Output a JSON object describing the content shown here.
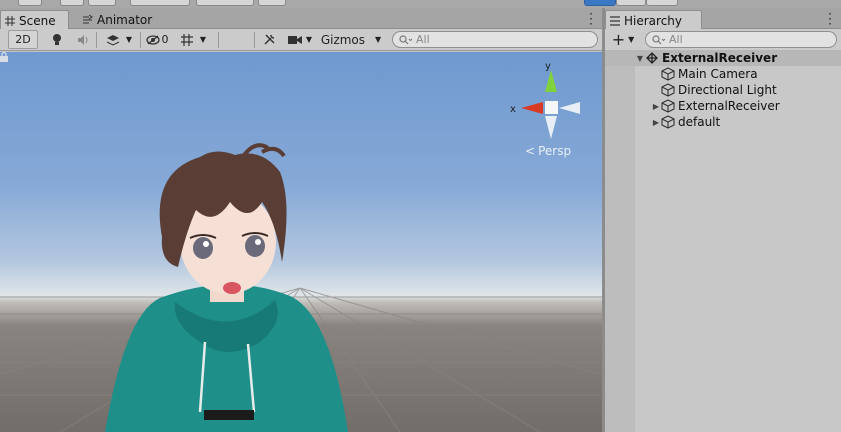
{
  "scene_window": {
    "tabs": [
      {
        "label": "Scene",
        "icon": "grid-icon",
        "active": true
      },
      {
        "label": "Animator",
        "icon": "animator-icon",
        "active": false
      }
    ],
    "toolbar": {
      "mode_2d": "2D",
      "hidden_count": "0",
      "gizmos_label": "Gizmos",
      "search_placeholder": "All"
    },
    "gizmo": {
      "x_label": "x",
      "y_label": "y",
      "projection_label": "Persp"
    }
  },
  "hierarchy": {
    "tab_label": "Hierarchy",
    "search_placeholder": "All",
    "items": [
      {
        "label": "ExternalReceiver",
        "icon": "unity-scene-icon",
        "expanded": true,
        "root": true
      },
      {
        "label": "Main Camera",
        "icon": "gameobject-cube-icon"
      },
      {
        "label": "Directional Light",
        "icon": "gameobject-cube-icon"
      },
      {
        "label": "ExternalReceiver",
        "icon": "gameobject-cube-icon",
        "collapsed": true
      },
      {
        "label": "default",
        "icon": "gameobject-cube-icon",
        "collapsed": true
      }
    ]
  },
  "colors": {
    "panel_bg": "#c8c8c8",
    "toolbar_bg": "#cbcbcb",
    "sky_top": "#6f99cf",
    "ground": "#736d69",
    "hoodie": "#1f8f8a",
    "gizmo_x": "#d83a26",
    "gizmo_y": "#7fd23b"
  }
}
